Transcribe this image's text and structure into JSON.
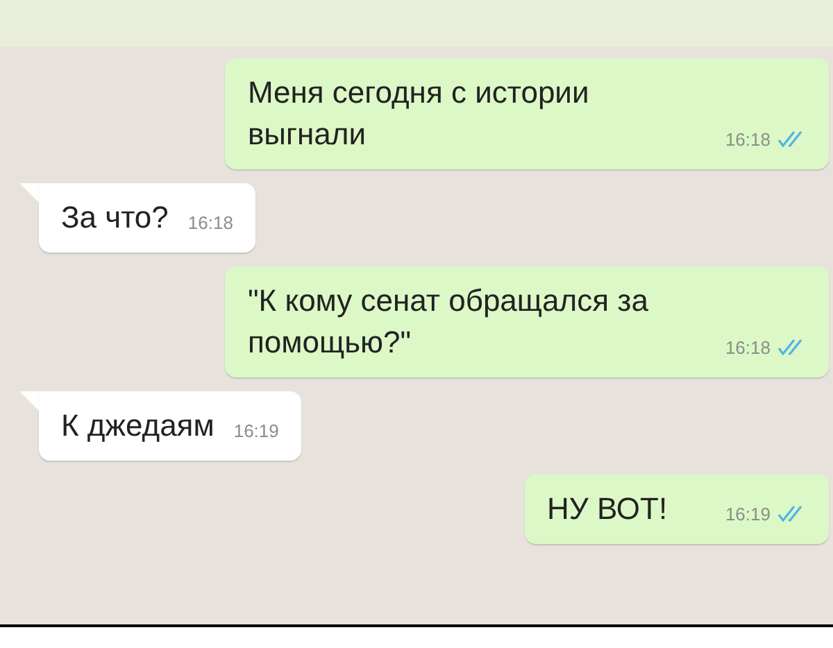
{
  "messages": [
    {
      "kind": "outgoing",
      "text": "Меня сегодня с истории выгнали",
      "time": "16:18",
      "read": true
    },
    {
      "kind": "incoming",
      "text": "За что?",
      "time": "16:18"
    },
    {
      "kind": "outgoing",
      "text": "\"К кому сенат обращался за помощью?\"",
      "time": "16:18",
      "read": true
    },
    {
      "kind": "incoming",
      "text": "К джедаям",
      "time": "16:19"
    },
    {
      "kind": "outgoing",
      "text": "НУ ВОТ!",
      "time": "16:19",
      "read": true
    }
  ]
}
